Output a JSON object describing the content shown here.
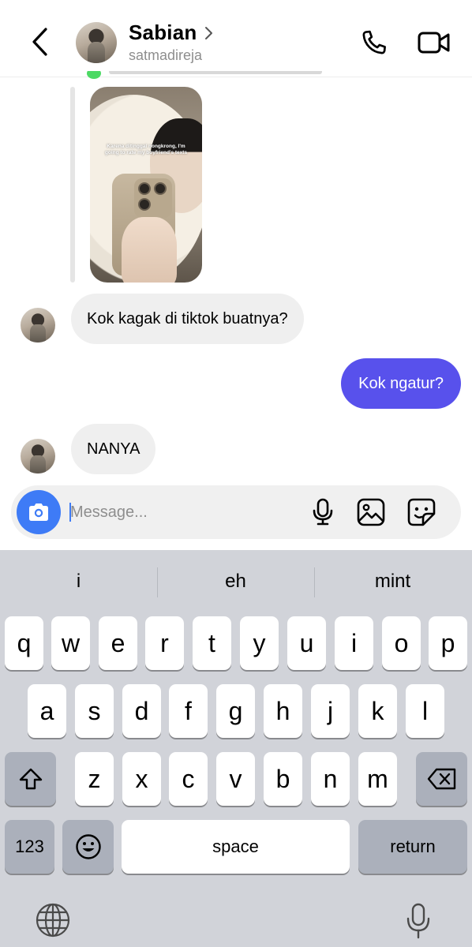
{
  "header": {
    "name": "Sabian",
    "handle": "satmadireja"
  },
  "shared_post": {
    "caption": "Karena ditinggal nongkrong, I'm going to rate my boyfriend's texts"
  },
  "messages": [
    {
      "direction": "incoming",
      "text": "Kok kagak di tiktok buatnya?"
    },
    {
      "direction": "outgoing",
      "text": "Kok ngatur?"
    },
    {
      "direction": "incoming",
      "text": "NANYA"
    }
  ],
  "composer": {
    "placeholder": "Message..."
  },
  "keyboard": {
    "suggestions": [
      "i",
      "eh",
      "mint"
    ],
    "row1": [
      "q",
      "w",
      "e",
      "r",
      "t",
      "y",
      "u",
      "i",
      "o",
      "p"
    ],
    "row2": [
      "a",
      "s",
      "d",
      "f",
      "g",
      "h",
      "j",
      "k",
      "l"
    ],
    "row3": [
      "z",
      "x",
      "c",
      "v",
      "b",
      "n",
      "m"
    ],
    "numbers_label": "123",
    "space_label": "space",
    "return_label": "return"
  },
  "colors": {
    "outgoing_bubble": "#5851ec",
    "incoming_bubble": "#efefef",
    "camera_button": "#3e7bf6",
    "keyboard_bg": "#d1d3d9"
  },
  "icons": [
    "back-chevron",
    "phone",
    "video-camera",
    "camera",
    "microphone",
    "gallery",
    "sticker",
    "shift",
    "backspace",
    "emoji",
    "globe",
    "dictation-microphone"
  ]
}
